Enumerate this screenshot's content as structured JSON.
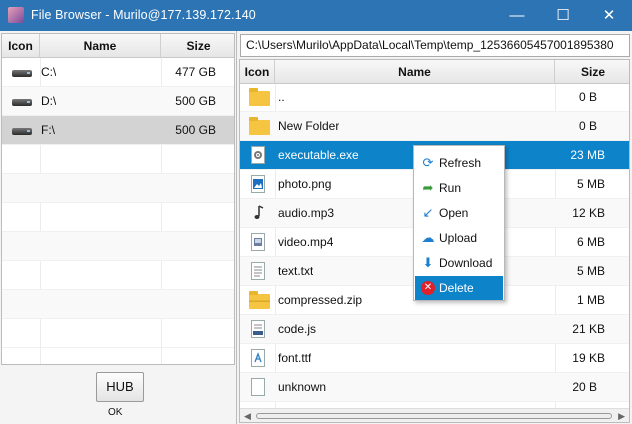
{
  "window": {
    "title": "File Browser - Murilo@177.139.172.140",
    "minimize": "—",
    "maximize": "☐",
    "close": "✕"
  },
  "drives_table": {
    "headers": {
      "icon": "Icon",
      "name": "Name",
      "size": "Size"
    },
    "rows": [
      {
        "name": "C:\\",
        "size": "477 GB"
      },
      {
        "name": "D:\\",
        "size": "500 GB"
      },
      {
        "name": "F:\\",
        "size": "500 GB"
      }
    ]
  },
  "hub": {
    "button_label": "HUB",
    "status": "OK"
  },
  "path": {
    "value": "C:\\Users\\Murilo\\AppData\\Local\\Temp\\temp_12536605457001895380"
  },
  "files_table": {
    "headers": {
      "icon": "Icon",
      "name": "Name",
      "size": "Size"
    },
    "rows": [
      {
        "name": "..",
        "size": "0 B",
        "icon": "folder-icon"
      },
      {
        "name": "New Folder",
        "size": "0 B",
        "icon": "folder-icon"
      },
      {
        "name": "executable.exe",
        "size": "23 MB",
        "icon": "gear-file-icon"
      },
      {
        "name": "photo.png",
        "size": "5 MB",
        "icon": "image-file-icon"
      },
      {
        "name": "audio.mp3",
        "size": "12 KB",
        "icon": "music-file-icon"
      },
      {
        "name": "video.mp4",
        "size": "6 MB",
        "icon": "video-file-icon"
      },
      {
        "name": "text.txt",
        "size": "5 MB",
        "icon": "text-file-icon"
      },
      {
        "name": "compressed.zip",
        "size": "1 MB",
        "icon": "zip-folder-icon"
      },
      {
        "name": "code.js",
        "size": "21 KB",
        "icon": "code-file-icon"
      },
      {
        "name": "font.ttf",
        "size": "19 KB",
        "icon": "font-file-icon"
      },
      {
        "name": "unknown",
        "size": "20 B",
        "icon": "blank-file-icon"
      }
    ]
  },
  "context_menu": {
    "items": [
      {
        "label": "Refresh",
        "icon": "refresh-icon"
      },
      {
        "label": "Run",
        "icon": "run-icon"
      },
      {
        "label": "Open",
        "icon": "open-icon"
      },
      {
        "label": "Upload",
        "icon": "upload-cloud-icon"
      },
      {
        "label": "Download",
        "icon": "download-icon"
      },
      {
        "label": "Delete",
        "icon": "delete-icon"
      }
    ]
  },
  "colors": {
    "titlebar": "#2c74b3",
    "selection": "#0d83c9",
    "delete": "#e0202a"
  }
}
